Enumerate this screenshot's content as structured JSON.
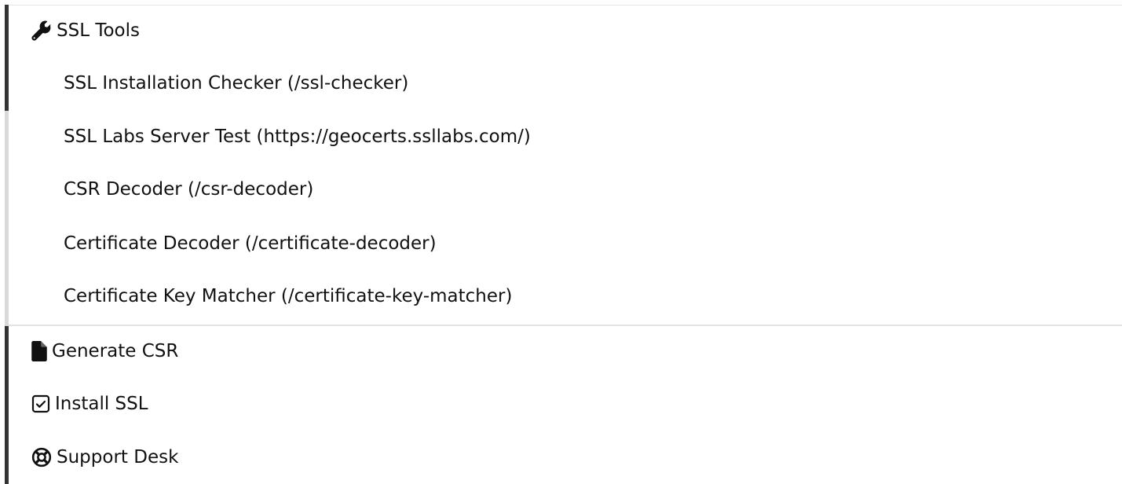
{
  "menu": {
    "ssl_tools": {
      "label": "SSL Tools",
      "icon": "wrench-icon",
      "items": [
        {
          "label": "SSL Installation Checker (/ssl-checker)"
        },
        {
          "label": "SSL Labs Server Test (https://geocerts.ssllabs.com/)"
        },
        {
          "label": "CSR Decoder (/csr-decoder)"
        },
        {
          "label": "Certificate Decoder (/certificate-decoder)"
        },
        {
          "label": "Certificate Key Matcher (/certificate-key-matcher)"
        }
      ]
    },
    "generate_csr": {
      "label": "Generate CSR",
      "icon": "file-icon"
    },
    "install_ssl": {
      "label": "Install SSL",
      "icon": "check-square-icon"
    },
    "support_desk": {
      "label": "Support Desk",
      "icon": "life-ring-icon"
    }
  }
}
